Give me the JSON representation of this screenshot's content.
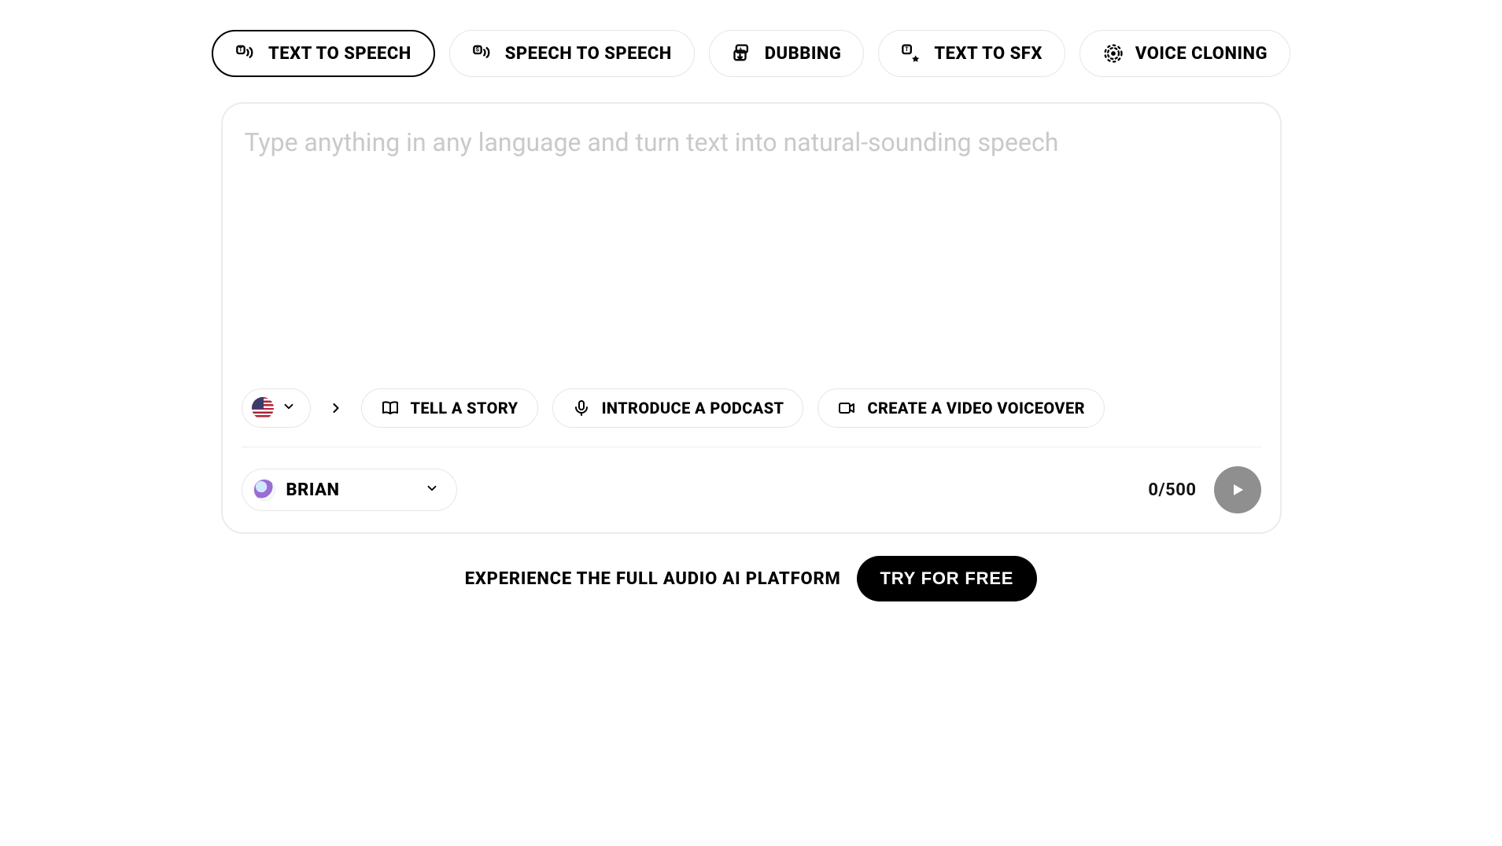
{
  "tabs": [
    {
      "id": "tts",
      "label": "TEXT TO SPEECH",
      "active": true
    },
    {
      "id": "sts",
      "label": "SPEECH TO SPEECH",
      "active": false
    },
    {
      "id": "dub",
      "label": "DUBBING",
      "active": false
    },
    {
      "id": "sfx",
      "label": "TEXT TO SFX",
      "active": false
    },
    {
      "id": "vc",
      "label": "VOICE CLONING",
      "active": false
    }
  ],
  "editor": {
    "placeholder": "Type anything in any language and turn text into natural-sounding speech",
    "value": ""
  },
  "language": {
    "code": "en-US"
  },
  "suggestions": [
    {
      "id": "story",
      "label": "TELL A STORY"
    },
    {
      "id": "podcast",
      "label": "INTRODUCE A PODCAST"
    },
    {
      "id": "video",
      "label": "CREATE A VIDEO VOICEOVER"
    }
  ],
  "voice": {
    "name": "BRIAN"
  },
  "counter": {
    "current": 0,
    "max": 500,
    "display": "0/500"
  },
  "cta": {
    "text": "EXPERIENCE THE FULL AUDIO AI PLATFORM",
    "button_label": "TRY FOR FREE"
  }
}
